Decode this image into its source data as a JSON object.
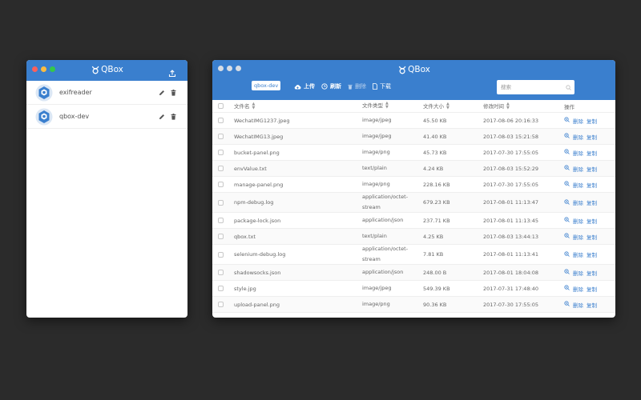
{
  "app": {
    "title": "QBox"
  },
  "buckets": [
    {
      "name": "exifreader"
    },
    {
      "name": "qbox-dev"
    }
  ],
  "explorer": {
    "current_bucket": "qbox-dev",
    "toolbar": {
      "upload": "上传",
      "refresh": "刷新",
      "delete": "删除",
      "download": "下载"
    },
    "search": {
      "placeholder": "搜索"
    },
    "columns": {
      "name": "文件名",
      "type": "文件类型",
      "size": "文件大小",
      "time": "修改时间",
      "ops": "操作"
    },
    "row_actions": {
      "delete": "删除",
      "copy": "复制"
    },
    "files": [
      {
        "name": "WechatIMG1237.jpeg",
        "type": "image/jpeg",
        "size": "45.50 KB",
        "time": "2017-08-06 20:16:33"
      },
      {
        "name": "WechatIMG13.jpeg",
        "type": "image/jpeg",
        "size": "41.40 KB",
        "time": "2017-08-03 15:21:58"
      },
      {
        "name": "bucket-panel.png",
        "type": "image/png",
        "size": "45.73 KB",
        "time": "2017-07-30 17:55:05"
      },
      {
        "name": "envValue.txt",
        "type": "text/plain",
        "size": "4.24 KB",
        "time": "2017-08-03 15:52:29"
      },
      {
        "name": "manage-panel.png",
        "type": "image/png",
        "size": "228.16 KB",
        "time": "2017-07-30 17:55:05"
      },
      {
        "name": "npm-debug.log",
        "type": "application/octet-stream",
        "size": "679.23 KB",
        "time": "2017-08-01 11:13:47"
      },
      {
        "name": "package-lock.json",
        "type": "application/json",
        "size": "237.71 KB",
        "time": "2017-08-01 11:13:45"
      },
      {
        "name": "qbox.txt",
        "type": "text/plain",
        "size": "4.25 KB",
        "time": "2017-08-03 13:44:13"
      },
      {
        "name": "selenium-debug.log",
        "type": "application/octet-stream",
        "size": "7.81 KB",
        "time": "2017-08-01 11:13:41"
      },
      {
        "name": "shadowsocks.json",
        "type": "application/json",
        "size": "248.00 B",
        "time": "2017-08-01 18:04:08"
      },
      {
        "name": "style.jpg",
        "type": "image/jpeg",
        "size": "549.39 KB",
        "time": "2017-07-31 17:48:40"
      },
      {
        "name": "upload-panel.png",
        "type": "image/png",
        "size": "90.36 KB",
        "time": "2017-07-30 17:55:05"
      }
    ]
  },
  "colors": {
    "accent": "#3a7fce",
    "background": "#2b2b2b"
  }
}
